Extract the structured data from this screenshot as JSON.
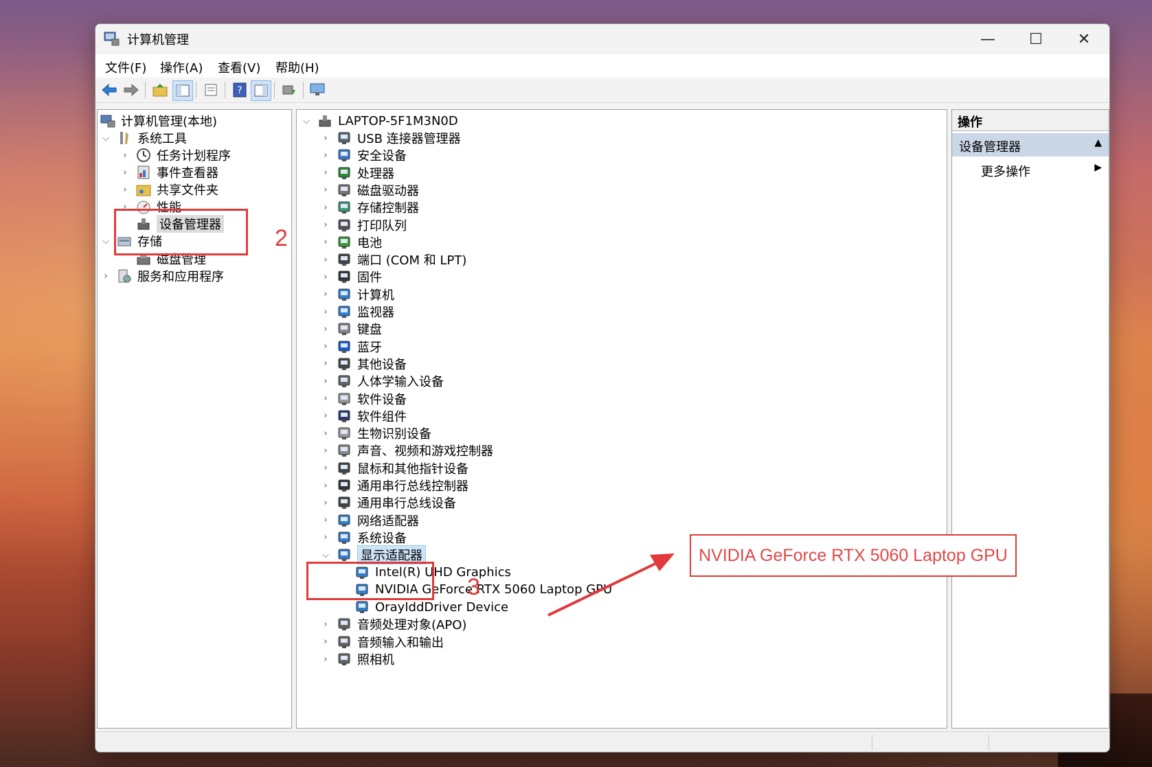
{
  "window": {
    "title": "计算机管理",
    "controls": {
      "minimize": "—",
      "maximize": "☐",
      "close": "✕"
    }
  },
  "menu": [
    "文件(F)",
    "操作(A)",
    "查看(V)",
    "帮助(H)"
  ],
  "left_tree": {
    "root": "计算机管理(本地)",
    "system_tools": "系统工具",
    "task_scheduler": "任务计划程序",
    "event_viewer": "事件查看器",
    "shared_folders": "共享文件夹",
    "performance": "性能",
    "device_manager": "设备管理器",
    "storage": "存储",
    "disk_management": "磁盘管理",
    "services_apps": "服务和应用程序"
  },
  "device_tree": {
    "computer": "LAPTOP-5F1M3N0D",
    "categories": [
      {
        "label": "USB 连接器管理器",
        "icon": "usb-icon"
      },
      {
        "label": "安全设备",
        "icon": "security-icon"
      },
      {
        "label": "处理器",
        "icon": "processor-icon"
      },
      {
        "label": "磁盘驱动器",
        "icon": "disk-drive-icon"
      },
      {
        "label": "存储控制器",
        "icon": "storage-controller-icon"
      },
      {
        "label": "打印队列",
        "icon": "printer-icon"
      },
      {
        "label": "电池",
        "icon": "battery-icon"
      },
      {
        "label": "端口 (COM 和 LPT)",
        "icon": "port-icon"
      },
      {
        "label": "固件",
        "icon": "firmware-icon"
      },
      {
        "label": "计算机",
        "icon": "computer-icon"
      },
      {
        "label": "监视器",
        "icon": "monitor-icon"
      },
      {
        "label": "键盘",
        "icon": "keyboard-icon"
      },
      {
        "label": "蓝牙",
        "icon": "bluetooth-icon"
      },
      {
        "label": "其他设备",
        "icon": "other-device-icon"
      },
      {
        "label": "人体学输入设备",
        "icon": "hid-icon"
      },
      {
        "label": "软件设备",
        "icon": "software-device-icon"
      },
      {
        "label": "软件组件",
        "icon": "software-component-icon"
      },
      {
        "label": "生物识别设备",
        "icon": "biometric-icon"
      },
      {
        "label": "声音、视频和游戏控制器",
        "icon": "sound-icon"
      },
      {
        "label": "鼠标和其他指针设备",
        "icon": "mouse-icon"
      },
      {
        "label": "通用串行总线控制器",
        "icon": "usb-controller-icon"
      },
      {
        "label": "通用串行总线设备",
        "icon": "usb-device-icon"
      },
      {
        "label": "网络适配器",
        "icon": "network-adapter-icon"
      },
      {
        "label": "系统设备",
        "icon": "system-device-icon"
      }
    ],
    "display_adapters": {
      "label": "显示适配器",
      "children": [
        "Intel(R) UHD Graphics",
        "NVIDIA GeForce RTX 5060 Laptop GPU",
        "OrayIddDriver Device"
      ]
    },
    "after": [
      {
        "label": "音频处理对象(APO)",
        "icon": "audio-apo-icon"
      },
      {
        "label": "音频输入和输出",
        "icon": "audio-io-icon"
      },
      {
        "label": "照相机",
        "icon": "camera-icon"
      }
    ]
  },
  "actions": {
    "header": "操作",
    "section": "设备管理器",
    "more": "更多操作"
  },
  "annotations": {
    "step2": "2",
    "step3": "3",
    "callout": "NVIDIA GeForce RTX 5060 Laptop GPU"
  }
}
